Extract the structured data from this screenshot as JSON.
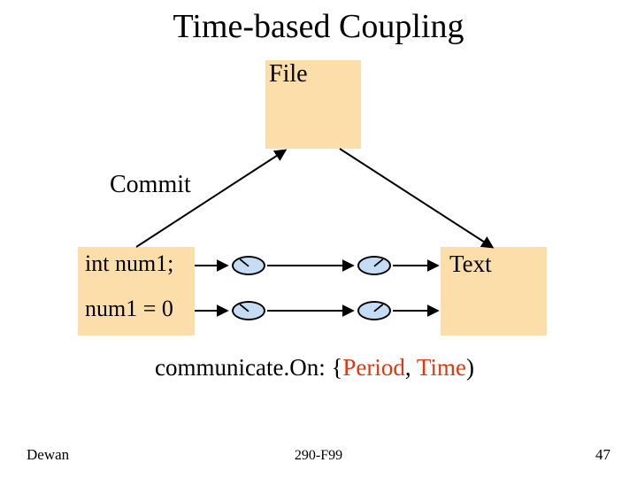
{
  "title": "Time-based Coupling",
  "labels": {
    "file": "File",
    "commit": "Commit",
    "intnum": "int num1;",
    "num0": "num1 = 0",
    "text": "Text"
  },
  "communicate": {
    "prefix": "communicate.On: {",
    "period": "Period",
    "sep": ", ",
    "time": "Time",
    "suffix": ")"
  },
  "footer": {
    "author": "Dewan",
    "course": "290-F99",
    "page": "47"
  }
}
